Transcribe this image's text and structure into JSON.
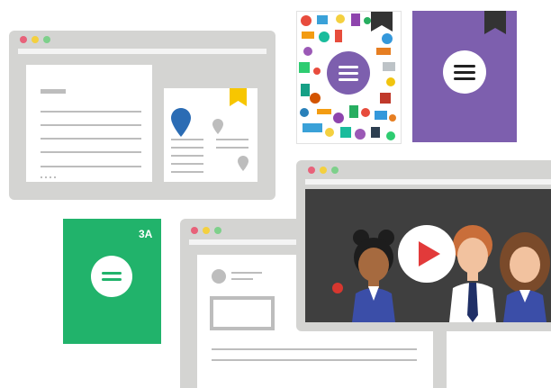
{
  "green_card": {
    "label": "3A"
  },
  "colors": {
    "window_frame": "#d4d4d2",
    "purple": "#7d5fae",
    "green": "#21b36b",
    "map_pin_blue": "#2b6cb4",
    "bookmark_yellow": "#f7c600",
    "video_bg": "#3f3f3f",
    "play_red": "#e23a3a"
  },
  "icons": {
    "menu": "menu-icon",
    "map_pin": "map-pin-icon",
    "bookmark": "bookmark-icon",
    "play": "play-icon"
  }
}
